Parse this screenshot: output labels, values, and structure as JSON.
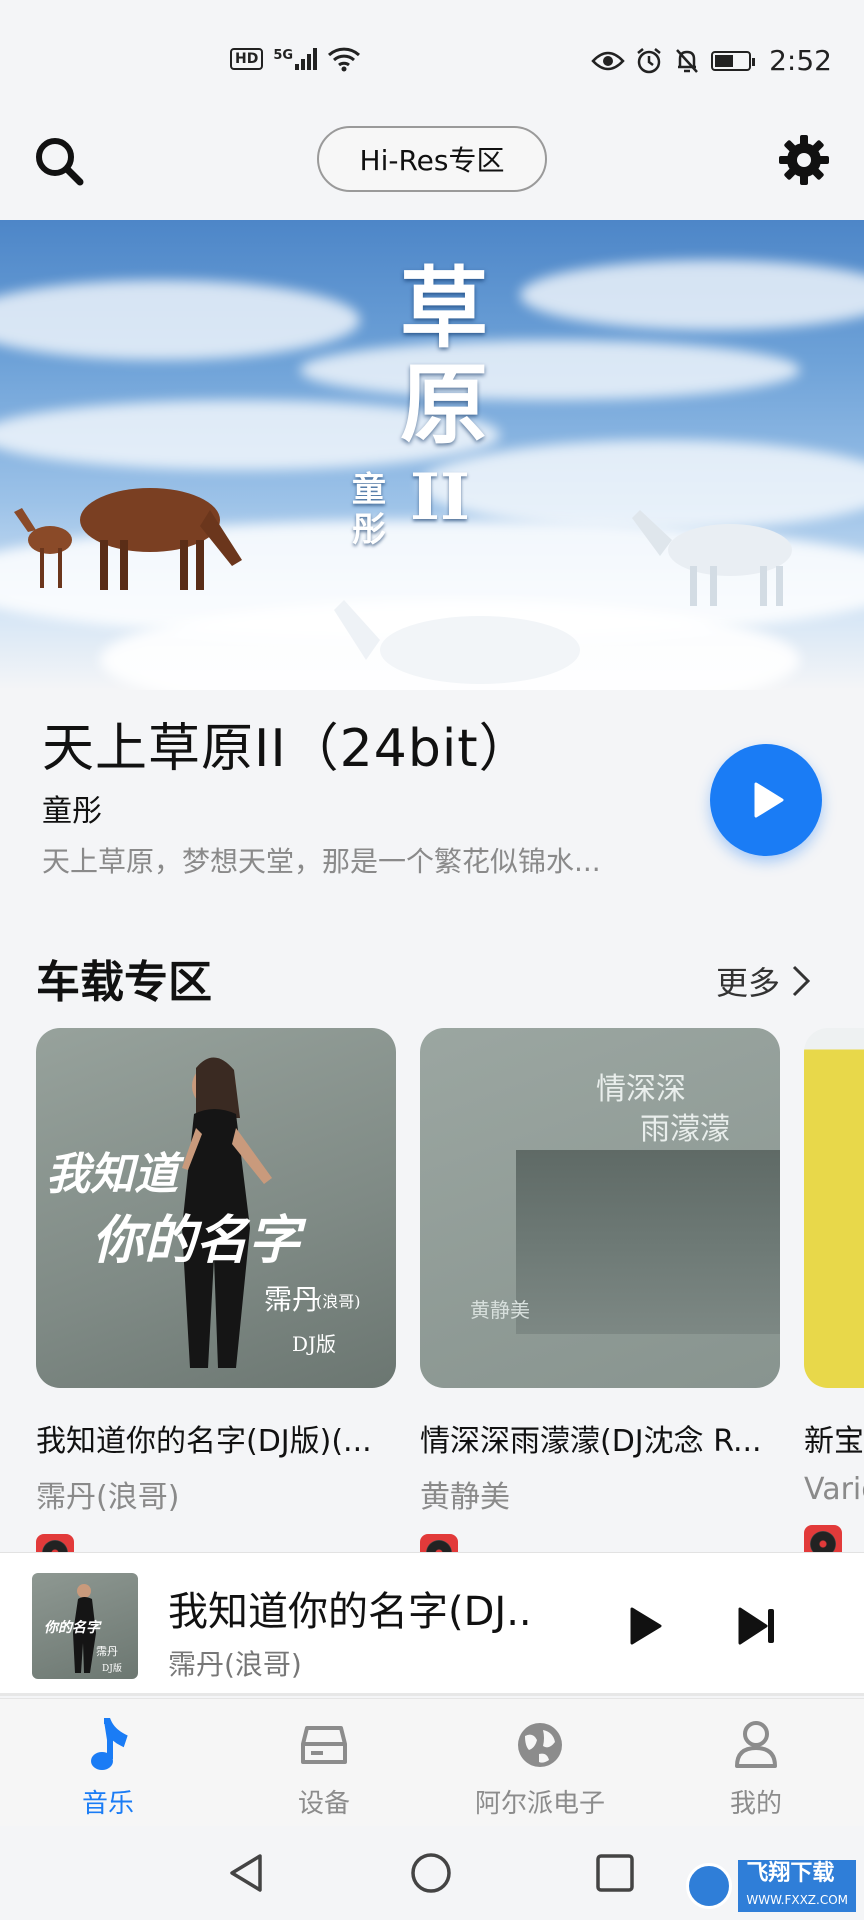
{
  "status_bar": {
    "network_badge": "HD",
    "network_type": "5G",
    "time": "2:52",
    "icons": [
      "hd-icon",
      "signal-icon",
      "wifi-icon",
      "eye-icon",
      "alarm-icon",
      "mute-icon",
      "battery-icon"
    ]
  },
  "top_bar": {
    "hires_label": "Hi-Res专区",
    "icons": [
      "search-icon",
      "gear-icon"
    ]
  },
  "banner": {
    "art_title_line1": "草",
    "art_title_line2": "原",
    "art_artist": "童彤",
    "art_roman": "II"
  },
  "featured": {
    "title": "天上草原II（24bit）",
    "artist": "童彤",
    "description": "天上草原，梦想天堂，那是一个繁花似锦水..."
  },
  "section": {
    "title": "车载专区",
    "more_label": "更多"
  },
  "cards": [
    {
      "name": "我知道你的名字(DJ版)(...",
      "artist": "霈丹(浪哥)",
      "cover_text": [
        "我知道",
        "你的名字",
        "霈丹",
        "(浪哥)",
        "DJ版"
      ]
    },
    {
      "name": "情深深雨濛濛(DJ沈念 R...",
      "artist": "黄静美",
      "cover_text": [
        "情深深",
        "雨濛濛",
        "黄静美"
      ]
    },
    {
      "name": "新宝",
      "artist": "Vario",
      "cover_text": []
    }
  ],
  "mini_player": {
    "title": "我知道你的名字(DJ..",
    "artist": "霈丹(浪哥)",
    "cover_text": [
      "你的名字",
      "霈丹",
      "DJ版"
    ]
  },
  "bottom_nav": [
    {
      "label": "音乐",
      "icon": "music-note-icon",
      "active": true
    },
    {
      "label": "设备",
      "icon": "device-icon",
      "active": false
    },
    {
      "label": "阿尔派电子",
      "icon": "globe-icon",
      "active": false
    },
    {
      "label": "我的",
      "icon": "person-icon",
      "active": false
    }
  ],
  "watermark": {
    "text": "飞翔下载",
    "sub": "WWW.FXXZ.COM"
  },
  "colors": {
    "accent": "#1a7cf5",
    "background": "#f4f5f7",
    "muted_text": "#8a8a8a"
  }
}
